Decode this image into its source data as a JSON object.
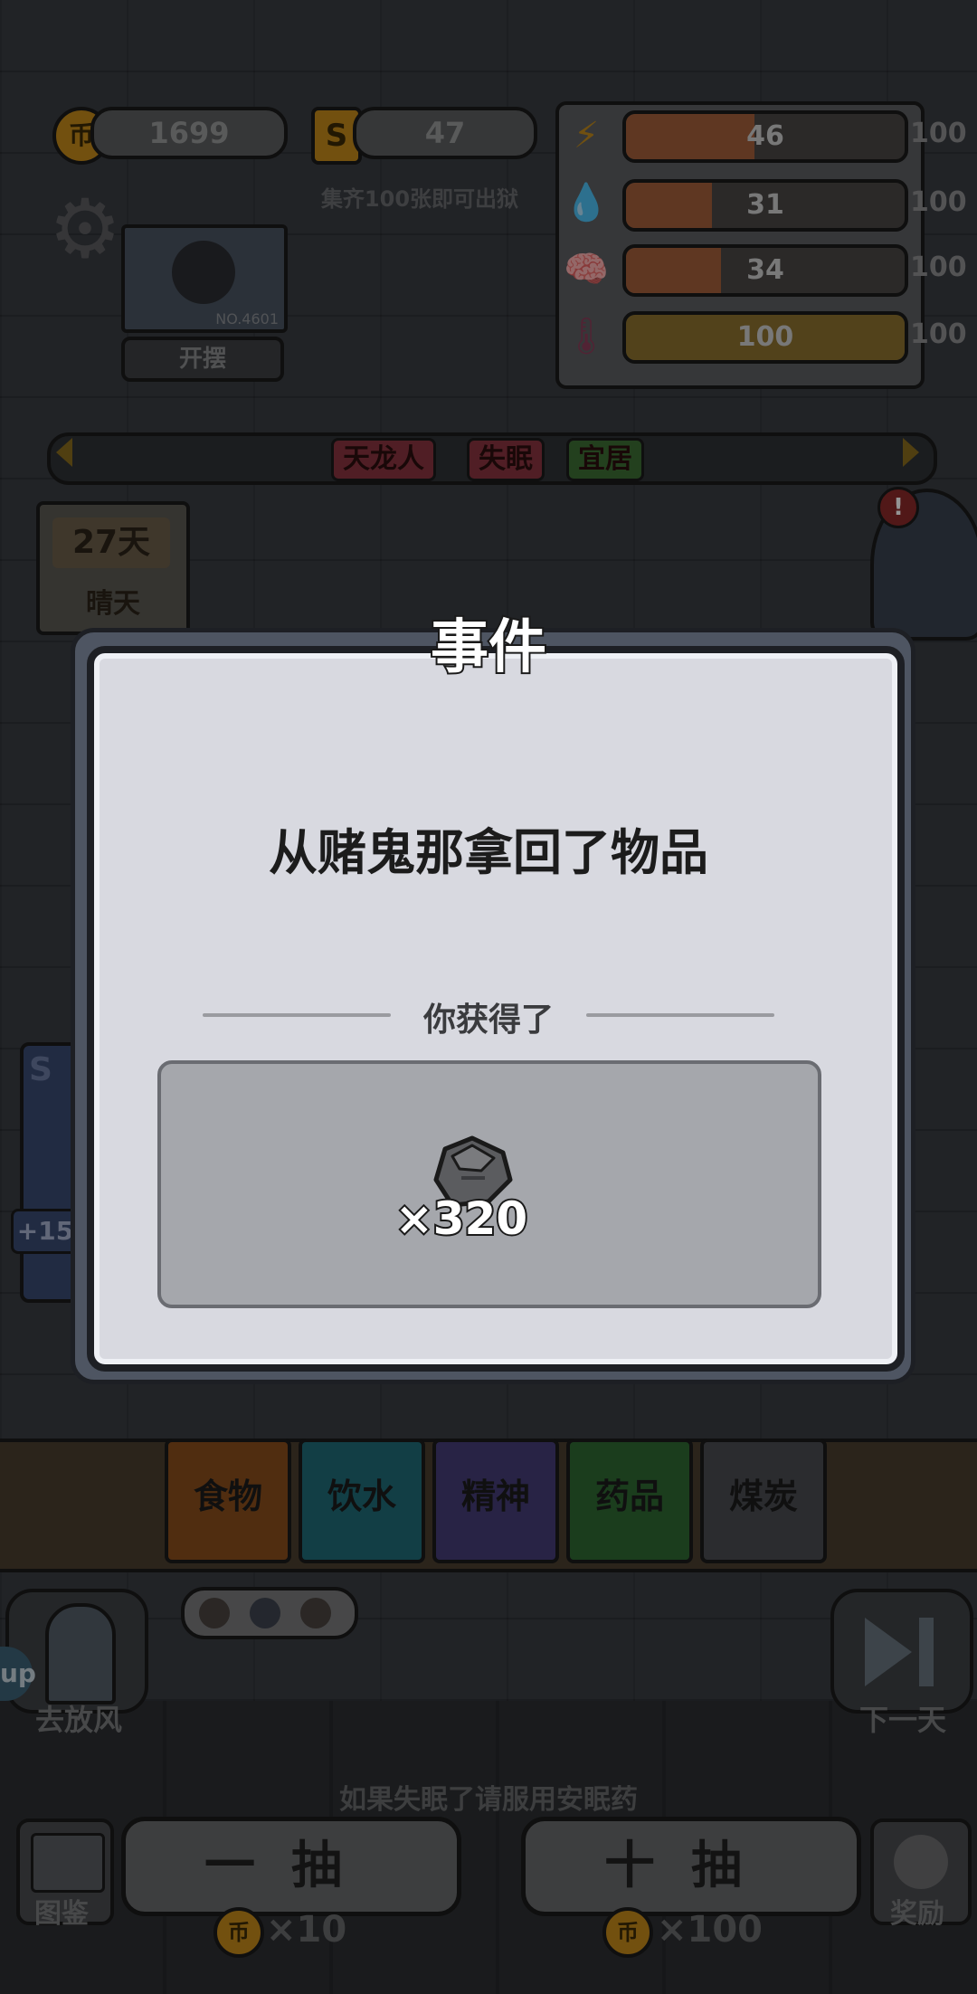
{
  "top_bar": {
    "coin_icon": "币",
    "coins": "1699",
    "card_icon": "S",
    "cards": "47",
    "collect_hint": "集齐100张即可出狱"
  },
  "stats": [
    {
      "name": "energy",
      "icon": "lightning-icon",
      "value": "46",
      "max": "100",
      "fill": 0.46,
      "color": "#d9764a"
    },
    {
      "name": "water",
      "icon": "water-drop-icon",
      "value": "31",
      "max": "100",
      "fill": 0.31,
      "color": "#d9764a"
    },
    {
      "name": "mind",
      "icon": "brain-icon",
      "value": "34",
      "max": "100",
      "fill": 0.34,
      "color": "#d9764a"
    },
    {
      "name": "temperature",
      "icon": "thermometer-icon",
      "value": "100",
      "max": "100",
      "fill": 1.0,
      "color": "#c9a33a"
    }
  ],
  "player": {
    "badge": "NO.4601",
    "status_button": "开摆"
  },
  "traits": [
    "天龙人",
    "失眠",
    "宜居"
  ],
  "day": {
    "count": "27天",
    "weather": "晴天"
  },
  "side_card": {
    "letter": "S",
    "bonus": "+15"
  },
  "categories": [
    "食物",
    "饮水",
    "精神",
    "药品",
    "煤炭"
  ],
  "bottom": {
    "release_button": "去放风",
    "next_day_button": "下一天",
    "tip": "如果失眠了请服用安眠药",
    "codex_button": "图鉴",
    "reward_button": "奖励",
    "draw_one": "一抽",
    "draw_one_cost": "×10",
    "draw_ten": "十抽",
    "draw_ten_cost": "×100",
    "coin_icon": "币",
    "up_badge": "up"
  },
  "modal": {
    "title": "事件",
    "message": "从赌鬼那拿回了物品",
    "reward_label": "你获得了",
    "reward_item": "coal-icon",
    "reward_quantity": "×320"
  }
}
